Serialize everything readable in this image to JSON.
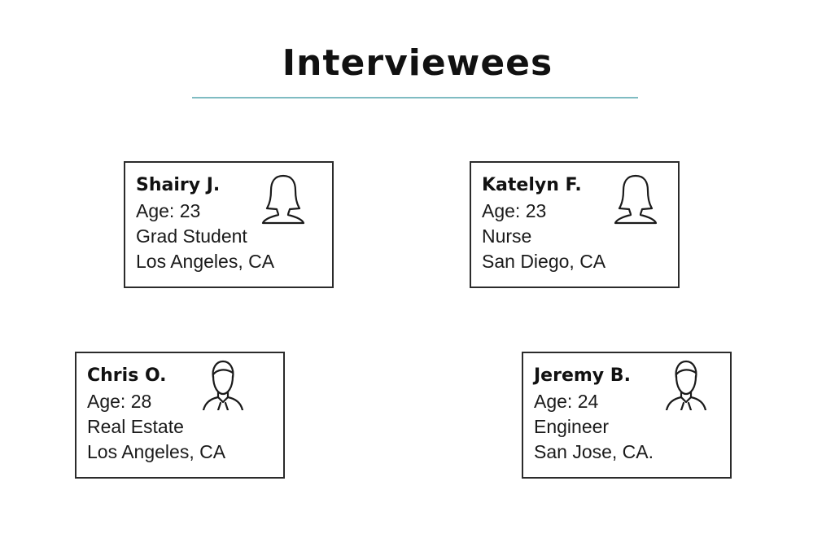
{
  "title": "Interviewees",
  "interviewees": [
    {
      "name": "Shairy J.",
      "age": "Age: 23",
      "occupation": "Grad Student",
      "location": "Los Angeles, CA",
      "icon": "female-user-icon"
    },
    {
      "name": "Katelyn F.",
      "age": "Age: 23",
      "occupation": "Nurse",
      "location": "San Diego, CA",
      "icon": "female-user-icon"
    },
    {
      "name": "Chris O.",
      "age": "Age: 28",
      "occupation": "Real Estate",
      "location": "Los Angeles, CA",
      "icon": "male-user-icon"
    },
    {
      "name": "Jeremy B.",
      "age": "Age: 24",
      "occupation": "Engineer",
      "location": "San Jose, CA.",
      "icon": "male-user-icon"
    }
  ],
  "colors": {
    "title_rule": "#7fbcc2",
    "card_border": "#2b2b2b"
  }
}
